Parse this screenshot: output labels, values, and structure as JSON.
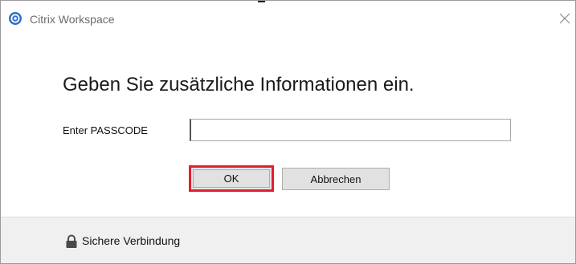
{
  "window": {
    "title": "Citrix Workspace",
    "close_glyph": "×"
  },
  "dialog": {
    "heading": "Geben Sie zusätzliche Informationen ein.",
    "field_label": "Enter PASSCODE",
    "passcode_value": "",
    "passcode_placeholder": "",
    "ok_label": "OK",
    "cancel_label": "Abbrechen"
  },
  "footer": {
    "status_text": "Sichere Verbindung",
    "lock_icon": "lock-icon"
  },
  "colors": {
    "highlight_border": "#e0202e",
    "app_icon_blue": "#2d6ec9",
    "footer_background": "#f0f0f0"
  }
}
